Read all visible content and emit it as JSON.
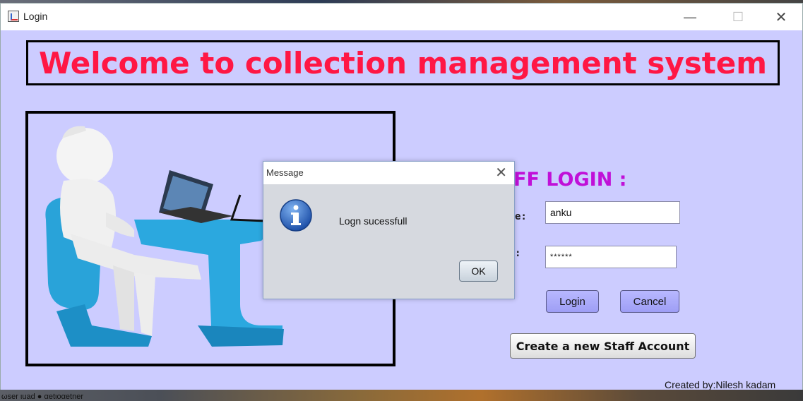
{
  "window": {
    "title": "Login"
  },
  "banner": {
    "text": "Welcome to collection management system"
  },
  "login": {
    "heading": "FF LOGIN :",
    "username_label": "e:",
    "password_label": ":",
    "username_value": "anku",
    "password_value": "******",
    "login_label": "Login",
    "cancel_label": "Cancel",
    "create_label": "Create a new Staff Account"
  },
  "footer": {
    "credits": "Created by:Nilesh kadam"
  },
  "dialog": {
    "title": "Message",
    "message": "Logn sucessfull",
    "ok_label": "OK",
    "icon": "info-icon"
  },
  "background": {
    "taskbar_text": "ωser   ιuad  ●  αetιoαetner"
  },
  "colors": {
    "window_bg": "#ccccff",
    "banner_text": "#ff1744",
    "heading": "#c010d8"
  }
}
